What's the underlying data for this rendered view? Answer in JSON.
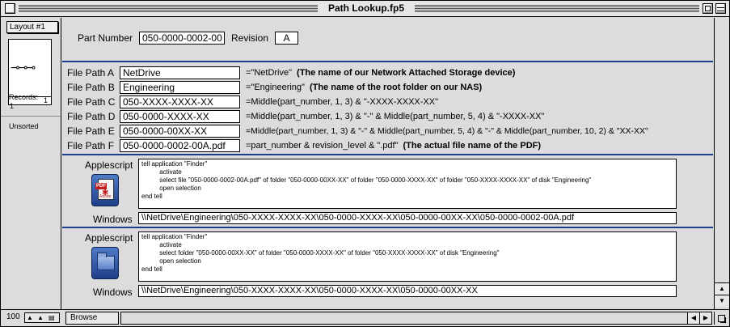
{
  "window": {
    "title": "Path Lookup.fp5"
  },
  "status": {
    "layout": "Layout #1",
    "page_number": "1",
    "records_label": "Records:",
    "records_count": "1",
    "sort": "Unsorted"
  },
  "part": {
    "number_label": "Part Number",
    "number_value": "050-0000-0002-00",
    "revision_label": "Revision",
    "revision_value": "A"
  },
  "paths": [
    {
      "label": "File Path A",
      "value": "NetDrive",
      "formula": "=\"NetDrive\"",
      "note": "(The name of our Network Attached Storage device)"
    },
    {
      "label": "File Path B",
      "value": "Engineering",
      "formula": "=\"Engineering\"",
      "note": "(The name of the root folder on our NAS)"
    },
    {
      "label": "File Path C",
      "value": "050-XXXX-XXXX-XX",
      "formula": "=Middle(part_number, 1, 3) & \"-XXXX-XXXX-XX\"",
      "note": ""
    },
    {
      "label": "File Path D",
      "value": "050-0000-XXXX-XX",
      "formula": "=Middle(part_number, 1, 3) & \"-\" & Middle(part_number, 5, 4) & \"-XXXX-XX\"",
      "note": ""
    },
    {
      "label": "File Path E",
      "value": "050-0000-00XX-XX",
      "formula": "=Middle(part_number, 1, 3) & \"-\" & Middle(part_number, 5, 4) & \"-\" & Middle(part_number, 10, 2) & \"XX-XX\"",
      "note": ""
    },
    {
      "label": "File Path F",
      "value": "050-0000-0002-00A.pdf",
      "formula": "=part_number & revision_level & \".pdf\"",
      "note": "(The actual file name of the PDF)"
    }
  ],
  "pdf_section": {
    "applescript_label": "Applescript",
    "script": "tell application \"Finder\"\n          activate\n          select file \"050-0000-0002-00A.pdf\" of folder \"050-0000-00XX-XX\" of folder \"050-0000-XXXX-XX\" of folder \"050-XXXX-XXXX-XX\" of disk \"Engineering\"\n          open selection\nend tell",
    "windows_label": "Windows",
    "windows_path": "\\\\NetDrive\\Engineering\\050-XXXX-XXXX-XX\\050-0000-XXXX-XX\\050-0000-00XX-XX\\050-0000-0002-00A.pdf",
    "icon_tag": "PDF",
    "icon_brand": "Adobe"
  },
  "folder_section": {
    "applescript_label": "Applescript",
    "script": "tell application \"Finder\"\n          activate\n          select folder \"050-0000-00XX-XX\" of folder \"050-0000-XXXX-XX\" of folder \"050-XXXX-XXXX-XX\" of disk \"Engineering\"\n          open selection\nend tell",
    "windows_label": "Windows",
    "windows_path": "\\\\NetDrive\\Engineering\\050-XXXX-XXXX-XX\\050-0000-XXXX-XX\\050-0000-00XX-XX"
  },
  "bottom": {
    "zoom": "100",
    "mode": "Browse"
  },
  "colors": {
    "divider": "#1c3c8c",
    "background": "#dcdcdc",
    "field": "#ffffff"
  }
}
